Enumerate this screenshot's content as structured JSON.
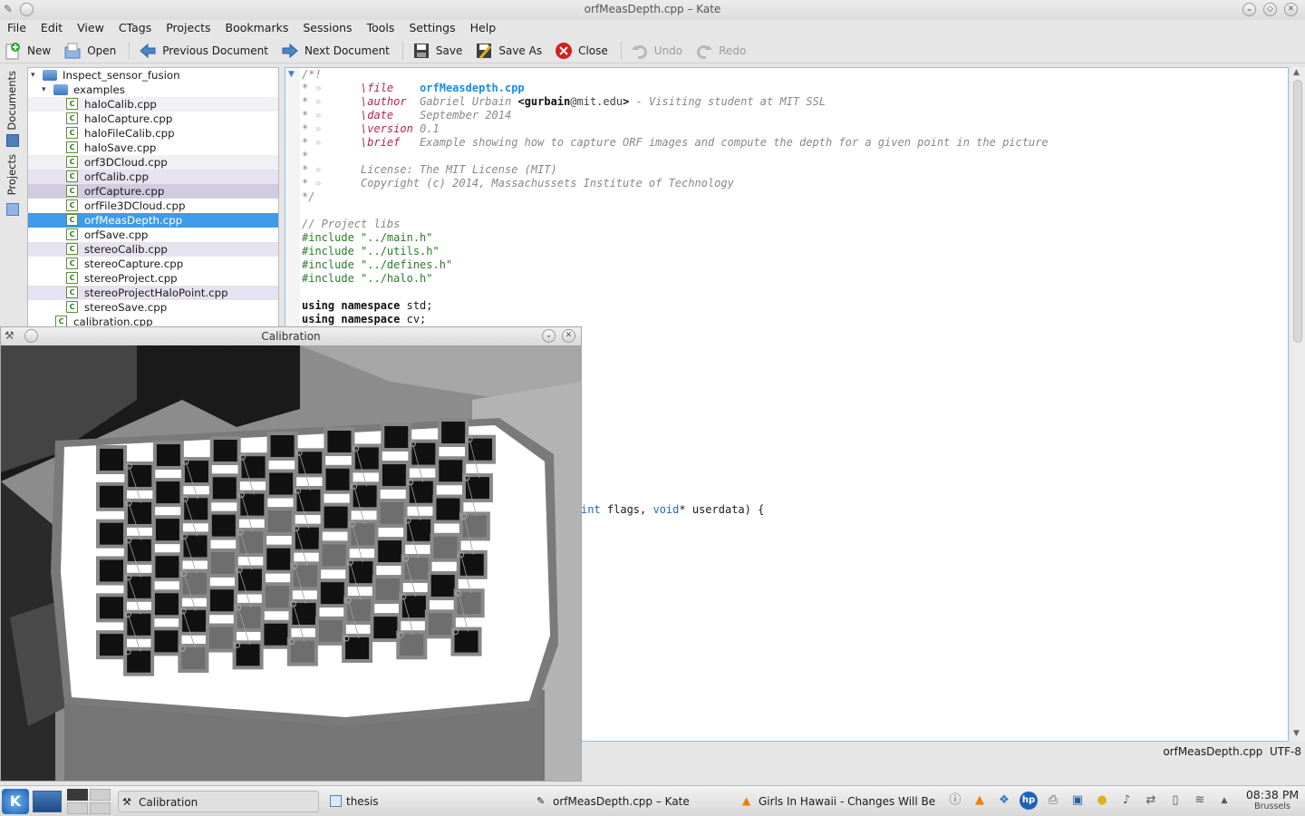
{
  "window": {
    "title": "orfMeasDepth.cpp – Kate"
  },
  "menu": [
    "File",
    "Edit",
    "View",
    "CTags",
    "Projects",
    "Bookmarks",
    "Sessions",
    "Tools",
    "Settings",
    "Help"
  ],
  "toolbar": {
    "new": "New",
    "open": "Open",
    "prev": "Previous Document",
    "next": "Next Document",
    "save": "Save",
    "save_as": "Save As",
    "close": "Close",
    "undo": "Undo",
    "redo": "Redo"
  },
  "sidetabs": {
    "documents": "Documents",
    "projects": "Projects"
  },
  "tree": {
    "root": "Inspect_sensor_fusion",
    "folder": "examples",
    "files": [
      "haloCalib.cpp",
      "haloCapture.cpp",
      "haloFileCalib.cpp",
      "haloSave.cpp",
      "orf3DCloud.cpp",
      "orfCalib.cpp",
      "orfCapture.cpp",
      "orfFile3DCloud.cpp",
      "orfMeasDepth.cpp",
      "orfSave.cpp",
      "stereoCalib.cpp",
      "stereoCapture.cpp",
      "stereoProject.cpp",
      "stereoProjectHaloPoint.cpp",
      "stereoSave.cpp"
    ],
    "selected": "orfMeasDepth.cpp",
    "last": "calibration.cpp"
  },
  "code": {
    "open": "/*!",
    "star": "*",
    "file_kw": "\\file",
    "file_val": "orfMeasdepth.cpp",
    "author_kw": "\\author",
    "author_name": "Gabriel Urbain",
    "author_email_open": "<",
    "author_user": "gurbain",
    "author_domain": "@mit.edu",
    "author_email_close": ">",
    "author_rest": "- Visiting student at MIT SSL",
    "date_kw": "\\date",
    "date_val": "September 2014",
    "version_kw": "\\version",
    "version_val": "0.1",
    "brief_kw": "\\brief",
    "brief_val": "Example showing how to capture ORF images and compute the depth for a given point in the picture",
    "license": "License: The MIT License (MIT)",
    "copyright": "Copyright (c) 2014, Massachussets Institute of Technology",
    "close": "*/",
    "libs_comment": "// Project libs",
    "includes": [
      "#include \"../main.h\"",
      "#include \"../utils.h\"",
      "#include \"../defines.h\"",
      "#include \"../halo.h\""
    ],
    "using1_kw": "using namespace",
    "using1": "std;",
    "using2_kw": "using namespace",
    "using2": "cv;",
    "partial_int": "int",
    "partial_rest": " flags, ",
    "partial_void": "void",
    "partial_end": "* userdata) {"
  },
  "status": {
    "filename": "orfMeasDepth.cpp",
    "encoding": "UTF-8"
  },
  "calibration": {
    "title": "Calibration"
  },
  "taskbar": {
    "tasks": [
      "Calibration",
      "thesis",
      "orfMeasDepth.cpp – Kate",
      "Girls In Hawaii - Changes Will Be Lo"
    ],
    "time": "08:38 PM",
    "city": "Brussels"
  },
  "colors": {
    "selection": "#3d9be9",
    "doxygen_keyword": "#b5244a",
    "doxygen_value": "#1b8ce0",
    "include": "#2a7a2a"
  }
}
